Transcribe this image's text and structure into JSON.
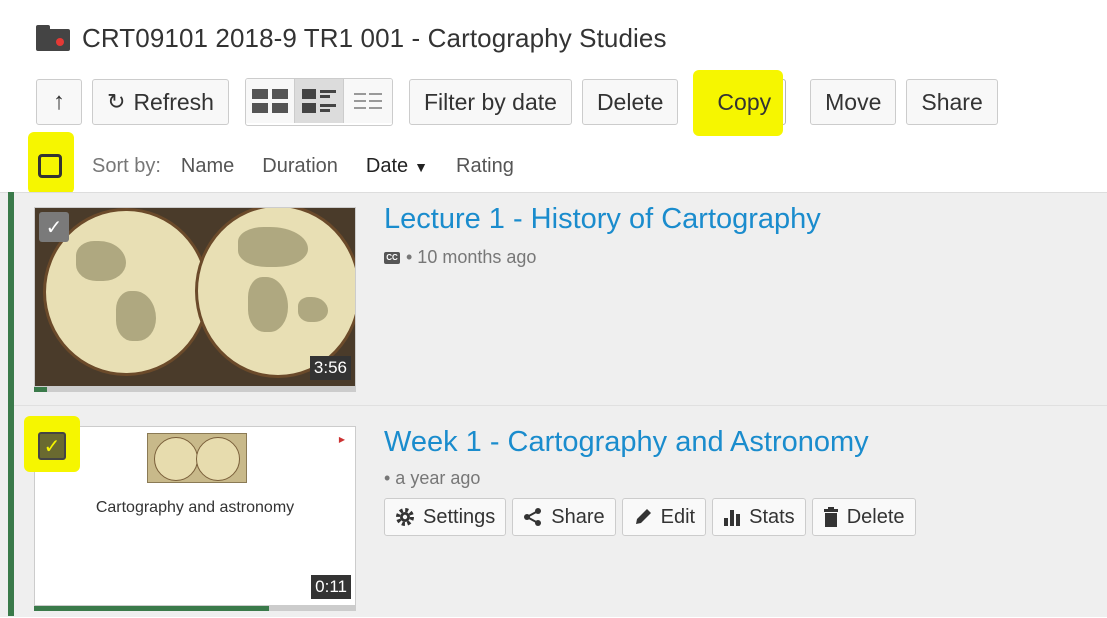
{
  "folder": {
    "title": "CRT09101 2018-9 TR1 001 - Cartography Studies"
  },
  "toolbar": {
    "up_glyph": "↑",
    "refresh_label": "Refresh",
    "refresh_glyph": "↻",
    "filter_label": "Filter by date",
    "delete_label": "Delete",
    "copy_label": "Copy",
    "move_label": "Move",
    "share_label": "Share",
    "active_view": "detail"
  },
  "sort": {
    "label": "Sort by:",
    "options": [
      "Name",
      "Duration",
      "Date",
      "Rating"
    ],
    "active": "Date",
    "caret": "▼"
  },
  "sessions": [
    {
      "title": "Lecture 1 - History of Cartography",
      "cc": "CC",
      "meta": "• 10 months ago",
      "duration": "3:56",
      "checked_glyph": "✓",
      "progress": 0.04
    },
    {
      "title": "Week 1 - Cartography and Astronomy",
      "meta": "• a year ago",
      "duration": "0:11",
      "slide_text": "Cartography and astronomy",
      "checked_glyph": "✓",
      "progress": 0.73,
      "actions": [
        {
          "icon": "gear-icon",
          "label": "Settings"
        },
        {
          "icon": "share-icon",
          "label": "Share"
        },
        {
          "icon": "pencil-icon",
          "label": "Edit"
        },
        {
          "icon": "bar-chart-icon",
          "label": "Stats"
        },
        {
          "icon": "trash-icon",
          "label": "Delete"
        }
      ]
    }
  ],
  "colors": {
    "highlight": "#f6f600",
    "link": "#1a8ccd",
    "accent_green": "#3a7a4a"
  }
}
